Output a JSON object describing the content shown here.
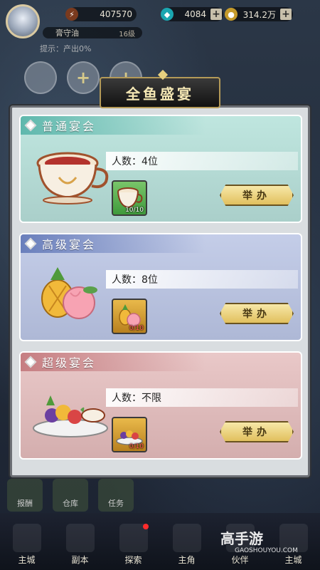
{
  "header": {
    "stamina_value": "407570",
    "gems_value": "4084",
    "gold_value": "314.2万",
    "player_name": "膏守油",
    "player_level": "16级",
    "hint_text": "提示：产出0%"
  },
  "panel": {
    "title": "全鱼盛宴",
    "cards": [
      {
        "title": "普通宴会",
        "people": "人数：4位",
        "item_count": "10/10",
        "button_label": "举办"
      },
      {
        "title": "高级宴会",
        "people": "人数：8位",
        "item_count": "0/10",
        "button_label": "举办"
      },
      {
        "title": "超级宴会",
        "people": "人数：不限",
        "item_count": "0/10",
        "button_label": "举办"
      }
    ]
  },
  "background_tabs": [
    "报酬",
    "仓库",
    "任务"
  ],
  "nav": {
    "items": [
      "主城",
      "副本",
      "探索",
      "主角",
      "伙伴",
      "主城"
    ]
  },
  "watermark": {
    "brand": "高手游",
    "domain": "GAOSHOUYOU.COM"
  },
  "colors": {
    "normal": "#5fb8ad",
    "high": "#6a7fbc",
    "super": "#c67e82",
    "button_gold": "#e1c05e"
  }
}
